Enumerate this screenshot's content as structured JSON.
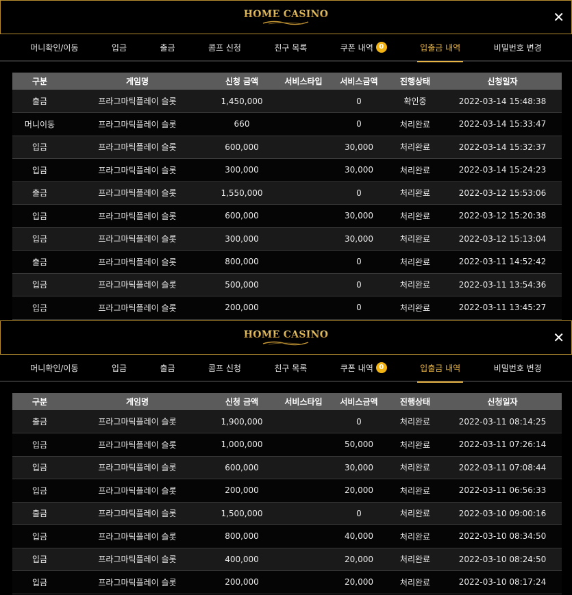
{
  "logo": {
    "text": "HOME CASINO"
  },
  "icons": {
    "close": "close-icon"
  },
  "colors": {
    "accent": "#e7b545",
    "border": "#b8902f",
    "badge": "#f2b315",
    "header_row": "#5b5b5b"
  },
  "tabs": [
    {
      "label": "머니확인/이동"
    },
    {
      "label": "입금"
    },
    {
      "label": "출금"
    },
    {
      "label": "콤프 신청"
    },
    {
      "label": "친구 목록"
    },
    {
      "label": "쿠폰 내역",
      "badge": "0"
    },
    {
      "label": "입출금 내역",
      "active": true
    },
    {
      "label": "비밀번호 변경"
    }
  ],
  "columns": [
    "구분",
    "게임명",
    "신청 금액",
    "서비스타입",
    "서비스금액",
    "진행상태",
    "신청일자"
  ],
  "panel1": {
    "rows": [
      [
        "출금",
        "프라그마틱플레이 슬롯",
        "1,450,000",
        "",
        "0",
        "확인중",
        "2022-03-14 15:48:38"
      ],
      [
        "머니이동",
        "프라그마틱플레이 슬롯",
        "660",
        "",
        "0",
        "처리완료",
        "2022-03-14 15:33:47"
      ],
      [
        "입금",
        "프라그마틱플레이 슬롯",
        "600,000",
        "",
        "30,000",
        "처리완료",
        "2022-03-14 15:32:37"
      ],
      [
        "입금",
        "프라그마틱플레이 슬롯",
        "300,000",
        "",
        "30,000",
        "처리완료",
        "2022-03-14 15:24:23"
      ],
      [
        "출금",
        "프라그마틱플레이 슬롯",
        "1,550,000",
        "",
        "0",
        "처리완료",
        "2022-03-12 15:53:06"
      ],
      [
        "입금",
        "프라그마틱플레이 슬롯",
        "600,000",
        "",
        "30,000",
        "처리완료",
        "2022-03-12 15:20:38"
      ],
      [
        "입금",
        "프라그마틱플레이 슬롯",
        "300,000",
        "",
        "30,000",
        "처리완료",
        "2022-03-12 15:13:04"
      ],
      [
        "출금",
        "프라그마틱플레이 슬롯",
        "800,000",
        "",
        "0",
        "처리완료",
        "2022-03-11 14:52:42"
      ],
      [
        "입금",
        "프라그마틱플레이 슬롯",
        "500,000",
        "",
        "0",
        "처리완료",
        "2022-03-11 13:54:36"
      ],
      [
        "입금",
        "프라그마틱플레이 슬롯",
        "200,000",
        "",
        "0",
        "처리완료",
        "2022-03-11 13:45:27"
      ]
    ]
  },
  "panel2": {
    "rows": [
      [
        "출금",
        "프라그마틱플레이 슬롯",
        "1,900,000",
        "",
        "0",
        "처리완료",
        "2022-03-11 08:14:25"
      ],
      [
        "입금",
        "프라그마틱플레이 슬롯",
        "1,000,000",
        "",
        "50,000",
        "처리완료",
        "2022-03-11 07:26:14"
      ],
      [
        "입금",
        "프라그마틱플레이 슬롯",
        "600,000",
        "",
        "30,000",
        "처리완료",
        "2022-03-11 07:08:44"
      ],
      [
        "입금",
        "프라그마틱플레이 슬롯",
        "200,000",
        "",
        "20,000",
        "처리완료",
        "2022-03-11 06:56:33"
      ],
      [
        "출금",
        "프라그마틱플레이 슬롯",
        "1,500,000",
        "",
        "0",
        "처리완료",
        "2022-03-10 09:00:16"
      ],
      [
        "입금",
        "프라그마틱플레이 슬롯",
        "800,000",
        "",
        "40,000",
        "처리완료",
        "2022-03-10 08:34:50"
      ],
      [
        "입금",
        "프라그마틱플레이 슬롯",
        "400,000",
        "",
        "20,000",
        "처리완료",
        "2022-03-10 08:24:50"
      ],
      [
        "입금",
        "프라그마틱플레이 슬롯",
        "200,000",
        "",
        "20,000",
        "처리완료",
        "2022-03-10 08:17:24"
      ]
    ]
  }
}
